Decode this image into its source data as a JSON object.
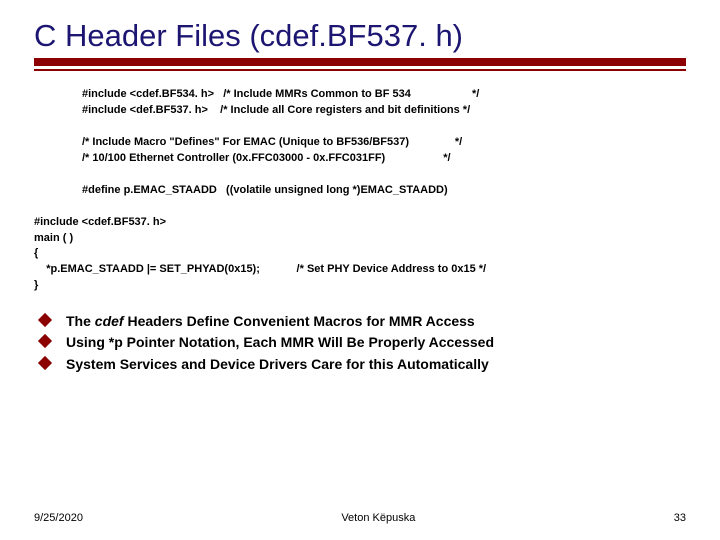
{
  "title": "C Header Files (cdef.BF537. h)",
  "code1_l1": "#include <cdef.BF534. h>   /* Include MMRs Common to BF 534                    */",
  "code1_l2": "#include <def.BF537. h>    /* Include all Core registers and bit definitions */",
  "code1_l3": "",
  "code1_l4": "/* Include Macro \"Defines\" For EMAC (Unique to BF536/BF537)               */",
  "code1_l5": "/* 10/100 Ethernet Controller (0x.FFC03000 - 0x.FFC031FF)                   */",
  "code1_l6": "",
  "code1_l7": "#define p.EMAC_STAADD   ((volatile unsigned long *)EMAC_STAADD)",
  "code2_l1": "#include <cdef.BF537. h>",
  "code2_l2": "main ( )",
  "code2_l3": "{",
  "code2_l4": "    *p.EMAC_STAADD |= SET_PHYAD(0x15);            /* Set PHY Device Address to 0x15 */",
  "code2_l5": "}",
  "bullets": {
    "b1_pre": "The ",
    "b1_em": "cdef",
    "b1_post": " Headers Define Convenient Macros for MMR Access",
    "b2": "Using *p Pointer Notation, Each MMR Will Be Properly Accessed",
    "b3": "System Services and Device Drivers Care for this Automatically"
  },
  "footer": {
    "date": "9/25/2020",
    "author": "Veton Këpuska",
    "page": "33"
  }
}
